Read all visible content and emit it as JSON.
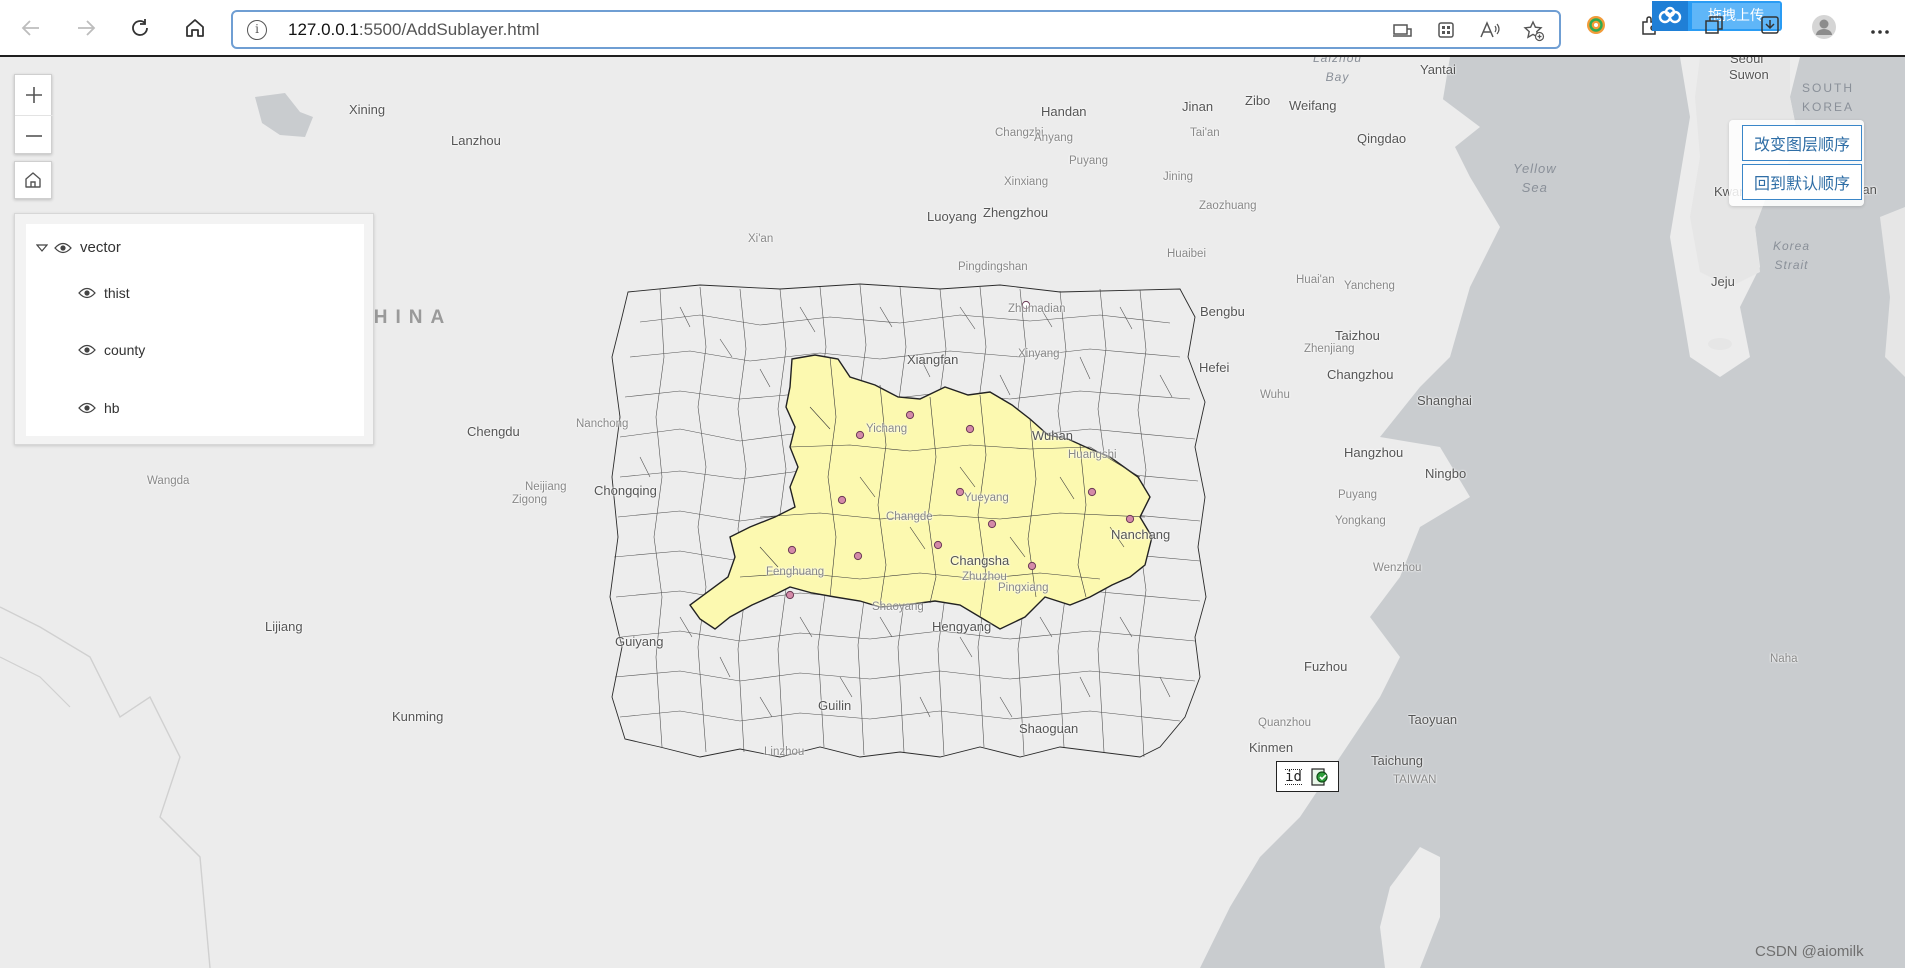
{
  "browser": {
    "url_prefix": "127.0.0.1",
    "url_rest": ":5500/AddSublayer.html",
    "info_icon": "i",
    "baidu_badge": "拖拽上传"
  },
  "map": {
    "country_label": "CHINA",
    "cities": [
      {
        "name": "Xining"
      },
      {
        "name": "Lanzhou"
      },
      {
        "name": "Handan"
      },
      {
        "name": "Jinan"
      },
      {
        "name": "Zibo"
      },
      {
        "name": "Weifang"
      },
      {
        "name": "Yantai"
      },
      {
        "name": "Seoul"
      },
      {
        "name": "Suwon"
      },
      {
        "name": "Changzhi"
      },
      {
        "name": "Anyang"
      },
      {
        "name": "Tai'an"
      },
      {
        "name": "Qingdao"
      },
      {
        "name": "Puyang"
      },
      {
        "name": "Xinxiang"
      },
      {
        "name": "Jining"
      },
      {
        "name": "Luoyang"
      },
      {
        "name": "Zhengzhou"
      },
      {
        "name": "Zaozhuang"
      },
      {
        "name": "Kwangju"
      },
      {
        "name": "Busan"
      },
      {
        "name": "Xi'an"
      },
      {
        "name": "Pingdingshan"
      },
      {
        "name": "Huaibei"
      },
      {
        "name": "Huai'an"
      },
      {
        "name": "Yancheng"
      },
      {
        "name": "Jeju"
      },
      {
        "name": "Zhumadian"
      },
      {
        "name": "Bengbu"
      },
      {
        "name": "Taizhou"
      },
      {
        "name": "Zhenjiang"
      },
      {
        "name": "Xiangfan"
      },
      {
        "name": "Xinyang"
      },
      {
        "name": "Hefei"
      },
      {
        "name": "Changzhou"
      },
      {
        "name": "Wuhu"
      },
      {
        "name": "Shanghai"
      },
      {
        "name": "Chengdu"
      },
      {
        "name": "Nanchong"
      },
      {
        "name": "Yichang"
      },
      {
        "name": "Wuhan"
      },
      {
        "name": "Huangshi"
      },
      {
        "name": "Hangzhou"
      },
      {
        "name": "Ningbo"
      },
      {
        "name": "Wangda"
      },
      {
        "name": "Neijiang"
      },
      {
        "name": "Zigong"
      },
      {
        "name": "Chongqing"
      },
      {
        "name": "Yueyang"
      },
      {
        "name": "Changde"
      },
      {
        "name": "Puyang"
      },
      {
        "name": "Yongkang"
      },
      {
        "name": "Nanchang"
      },
      {
        "name": "Changsha"
      },
      {
        "name": "Zhuzhou"
      },
      {
        "name": "Fenghuang"
      },
      {
        "name": "Pingxiang"
      },
      {
        "name": "Wenzhou"
      },
      {
        "name": "Shaoyang"
      },
      {
        "name": "Lijiang"
      },
      {
        "name": "Guiyang"
      },
      {
        "name": "Hengyang"
      },
      {
        "name": "Fuzhou"
      },
      {
        "name": "Naha"
      },
      {
        "name": "Kunming"
      },
      {
        "name": "Guilin"
      },
      {
        "name": "Shaoguan"
      },
      {
        "name": "Quanzhou"
      },
      {
        "name": "Taoyuan"
      },
      {
        "name": "Kinmen"
      },
      {
        "name": "Linzhou"
      },
      {
        "name": "Taichung"
      },
      {
        "name": "TAIWAN"
      },
      {
        "name": "Fuzhou"
      }
    ],
    "seas": [
      {
        "text": "Yellow\nSea"
      },
      {
        "text": "Korea\nStrait"
      },
      {
        "text": "SOUTH\nKOREA"
      },
      {
        "text": "Laizhou\nBay"
      }
    ]
  },
  "layer_list": {
    "group": {
      "label": "vector"
    },
    "children": [
      {
        "label": "thist"
      },
      {
        "label": "county"
      },
      {
        "label": "hb"
      }
    ]
  },
  "order_buttons": {
    "change_order": "改变图层顺序",
    "default_order": "回到默认顺序"
  },
  "id_widget": {
    "label": "id"
  },
  "watermark": "CSDN @aiomilk"
}
